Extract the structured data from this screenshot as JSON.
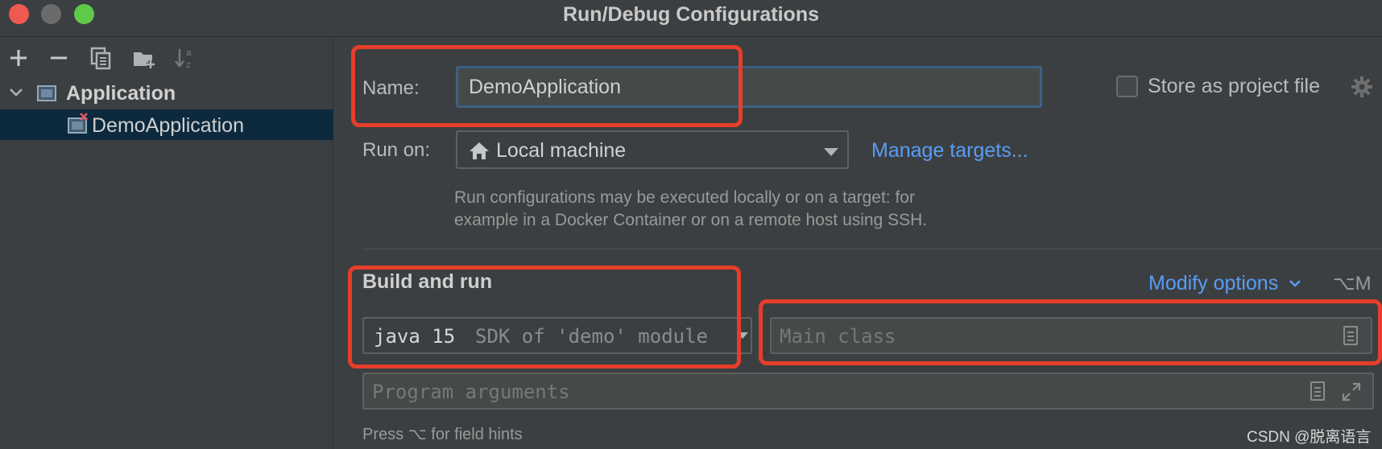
{
  "window": {
    "title": "Run/Debug Configurations"
  },
  "toolbar": {
    "icons": [
      "add-icon",
      "remove-icon",
      "copy-icon",
      "folder-add-icon",
      "sort-icon"
    ]
  },
  "tree": {
    "group_label": "Application",
    "item_label": "DemoApplication"
  },
  "form": {
    "name_label": "Name:",
    "name_value": "DemoApplication",
    "store_label": "Store as project file",
    "runon_label": "Run on:",
    "runon_value": "Local machine",
    "manage_targets": "Manage targets...",
    "hint_line1": "Run configurations may be executed locally or on a target: for",
    "hint_line2": "example in a Docker Container or on a remote host using SSH.",
    "section_title": "Build and run",
    "modify_options": "Modify options",
    "modify_shortcut": "⌥M",
    "sdk_main": "java 15",
    "sdk_sub": "SDK of 'demo' module",
    "main_class_placeholder": "Main class",
    "program_args_placeholder": "Program arguments",
    "footer_hint": "Press ⌥ for field hints"
  },
  "watermark": "CSDN @脱离语言",
  "colors": {
    "background": "#3c3f41",
    "link": "#589df6",
    "selection": "#0d293e",
    "annotation": "#e53e2b"
  }
}
